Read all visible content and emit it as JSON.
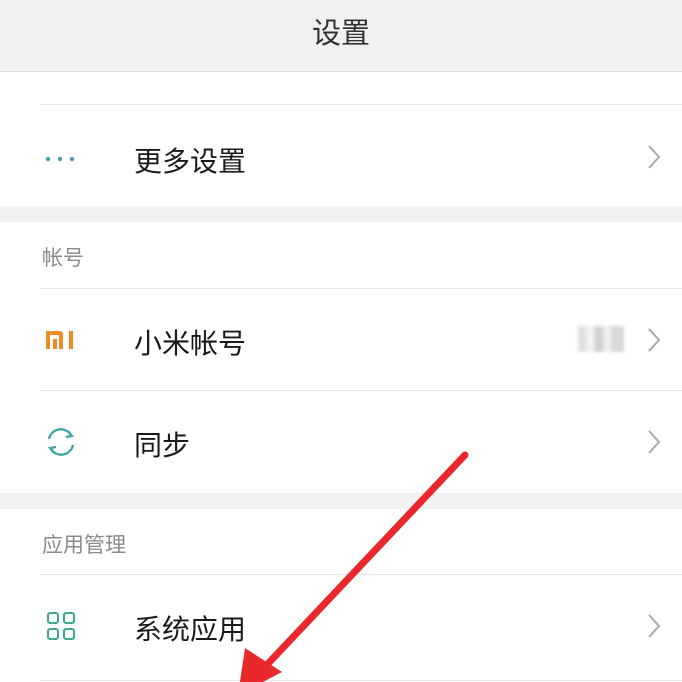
{
  "header": {
    "title": "设置"
  },
  "rows": {
    "more_settings": {
      "label": "更多设置",
      "icon": "more-dots-icon"
    },
    "mi_account": {
      "label": "小米帐号",
      "icon": "mi-logo-icon",
      "value": ""
    },
    "sync": {
      "label": "同步",
      "icon": "sync-icon"
    },
    "system_apps": {
      "label": "系统应用",
      "icon": "grid-apps-icon"
    }
  },
  "sections": {
    "account": {
      "title": "帐号"
    },
    "app_management": {
      "title": "应用管理"
    }
  },
  "colors": {
    "header_bg": "#f1f1f1",
    "section_gap": "#f2f2f2",
    "mi_orange": "#f08a24",
    "teal_icon": "#39a3a3",
    "grid_icon": "#3ea88a",
    "annotation_arrow": "#e8282b"
  }
}
